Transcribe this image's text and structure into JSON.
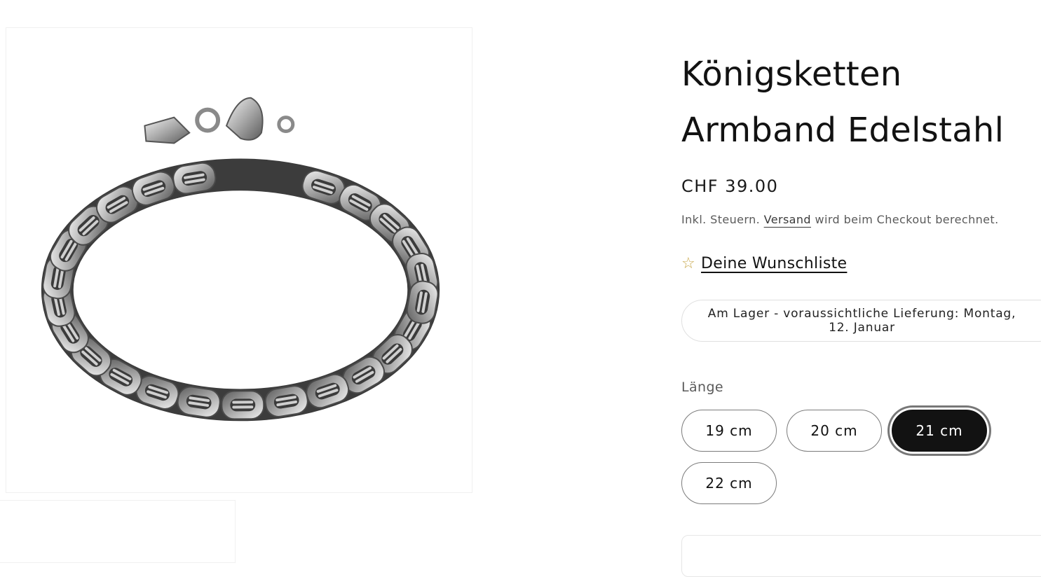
{
  "product": {
    "image_alt": "Königsketten Armband Edelstahl",
    "title_line1": "Königsketten",
    "title_line2": "Armband Edelstahl",
    "price": "CHF 39.00",
    "tax_prefix": "Inkl. Steuern.",
    "tax_link": "Versand",
    "tax_suffix": "wird beim Checkout berechnet.",
    "wishlist_icon": "star-outline-icon",
    "wishlist_label": "Deine Wunschliste",
    "stock_line1": "Am Lager - voraussichtliche Lieferung: Montag,",
    "stock_line2": "12. Januar",
    "option_label": "Länge",
    "options": [
      "19 cm",
      "20 cm",
      "21 cm",
      "22 cm"
    ],
    "selected_option": "21 cm"
  },
  "colors": {
    "text": "#121212",
    "star": "#c8a84b",
    "selected_bg": "#121212",
    "border": "#7b7b7b"
  }
}
